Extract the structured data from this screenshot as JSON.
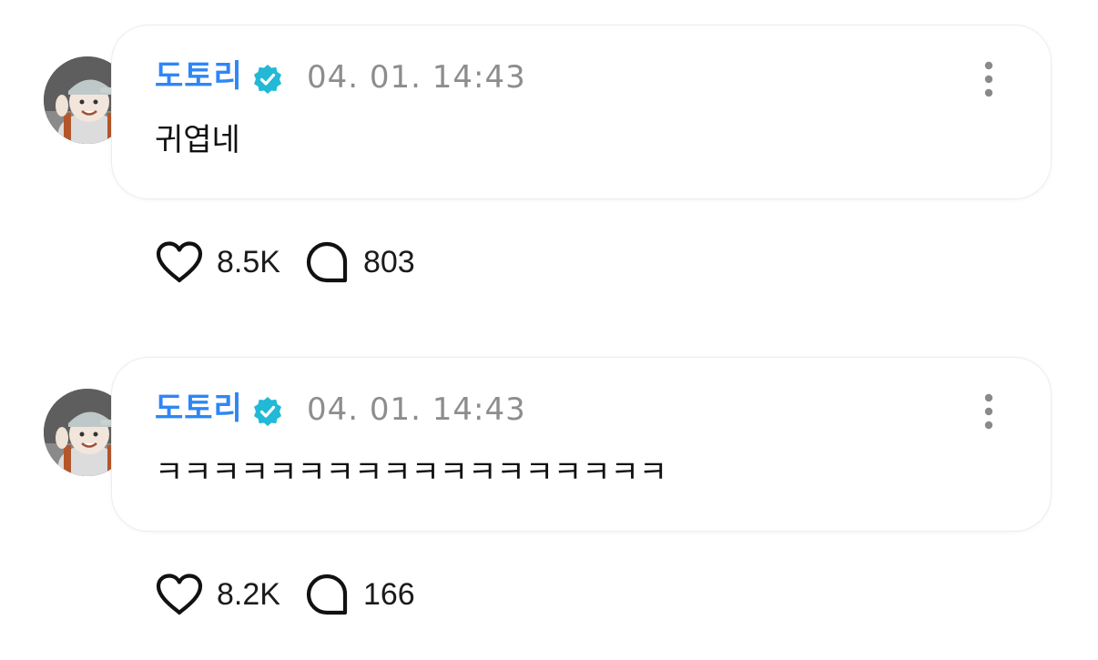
{
  "comments": [
    {
      "author": "도토리",
      "verified_icon": "verified-badge-icon",
      "timestamp": "04. 01. 14:43",
      "text": "귀엽네",
      "likes": "8.5K",
      "replies": "803"
    },
    {
      "author": "도토리",
      "verified_icon": "verified-badge-icon",
      "timestamp": "04. 01. 14:43",
      "text": "ㅋㅋㅋㅋㅋㅋㅋㅋㅋㅋㅋㅋㅋㅋㅋㅋㅋㅋ",
      "likes": "8.2K",
      "replies": "166"
    }
  ],
  "colors": {
    "author": "#2f86f6",
    "verified": "#21b9d6",
    "timestamp": "#8d8d8d"
  }
}
